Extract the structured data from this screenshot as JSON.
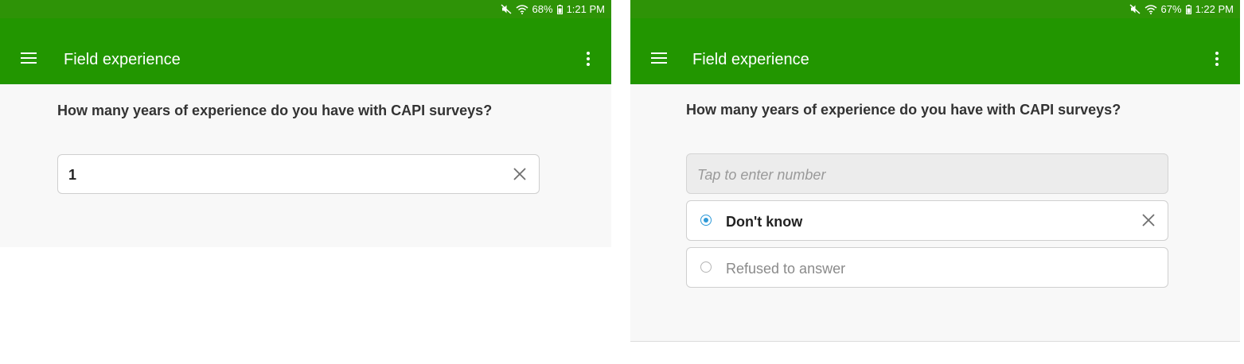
{
  "screens": [
    {
      "status_bar": {
        "battery": "68%",
        "time": "1:21 PM"
      },
      "app_bar": {
        "title": "Field experience"
      },
      "question": "How many years of experience do you have with CAPI surveys?",
      "answer": {
        "value": "1"
      }
    },
    {
      "status_bar": {
        "battery": "67%",
        "time": "1:22 PM"
      },
      "app_bar": {
        "title": "Field experience"
      },
      "question": "How many years of experience do you have with CAPI surveys?",
      "answer": {
        "placeholder": "Tap to enter number"
      },
      "options": [
        {
          "label": "Don't know",
          "selected": true
        },
        {
          "label": "Refused to answer",
          "selected": false
        }
      ]
    }
  ],
  "colors": {
    "app_bar": "#229600",
    "status_bar": "#2e9307",
    "radio_selected": "#2f9ad8"
  },
  "icons": [
    "mute-icon",
    "wifi-icon",
    "battery-icon",
    "menu-icon",
    "more-vert-icon",
    "clear-icon",
    "radio-icon"
  ]
}
